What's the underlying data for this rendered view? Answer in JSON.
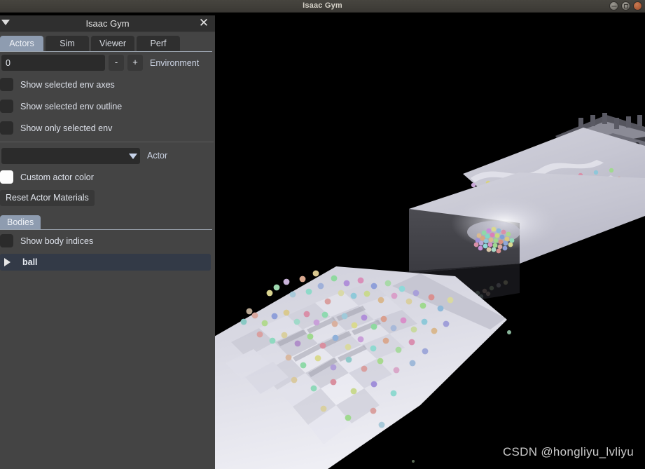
{
  "window": {
    "title": "Isaac Gym",
    "controls": [
      {
        "name": "minimize",
        "glyph": "minimize-icon"
      },
      {
        "name": "maximize",
        "glyph": "maximize-icon"
      },
      {
        "name": "close",
        "glyph": "close-icon"
      }
    ]
  },
  "panel": {
    "title": "Isaac Gym",
    "collapse_icon": "triangle-down-icon",
    "close_icon": "close-icon",
    "tabs": [
      {
        "label": "Actors",
        "active": true
      },
      {
        "label": "Sim",
        "active": false
      },
      {
        "label": "Viewer",
        "active": false
      },
      {
        "label": "Perf",
        "active": false
      }
    ],
    "environment": {
      "value": "0",
      "placeholder": "0",
      "decrement_label": "-",
      "increment_label": "+",
      "label": "Environment"
    },
    "checkboxes": [
      {
        "label": "Show selected env axes",
        "checked": false
      },
      {
        "label": "Show selected env outline",
        "checked": false
      },
      {
        "label": "Show only selected env",
        "checked": false
      }
    ],
    "actor_dropdown": {
      "value": "",
      "placeholder": "",
      "label": "Actor",
      "arrow_icon": "triangle-down-icon"
    },
    "custom_actor_color": {
      "label": "Custom actor color",
      "checked": true,
      "swatch_color": "#fdfdfd"
    },
    "reset_button": {
      "label": "Reset Actor Materials"
    },
    "bodies_section": {
      "tab_label": "Bodies",
      "show_body_indices": {
        "label": "Show body indices",
        "checked": false
      },
      "tree": [
        {
          "label": "ball",
          "expanded": false,
          "selected": true,
          "arrow_icon": "triangle-right-icon"
        }
      ]
    }
  },
  "viewport": {
    "watermark": "CSDN @hongliyu_lvliyu",
    "background_color": "#000000",
    "scene_description": "Isaac Gym terrain simulation with colored spheres on rough and stepped terrain tiles"
  },
  "colors": {
    "panel_background": "#444444",
    "panel_titlebar": "#2f2f2f",
    "tab_active": "#8e9cb0",
    "tab_inactive": "#2f2f2f",
    "input_background": "#2b2b2b",
    "button_background": "#383838",
    "selected_row": "#333a47",
    "os_titlebar": "#403e39",
    "text_primary": "#dfe3ea"
  }
}
